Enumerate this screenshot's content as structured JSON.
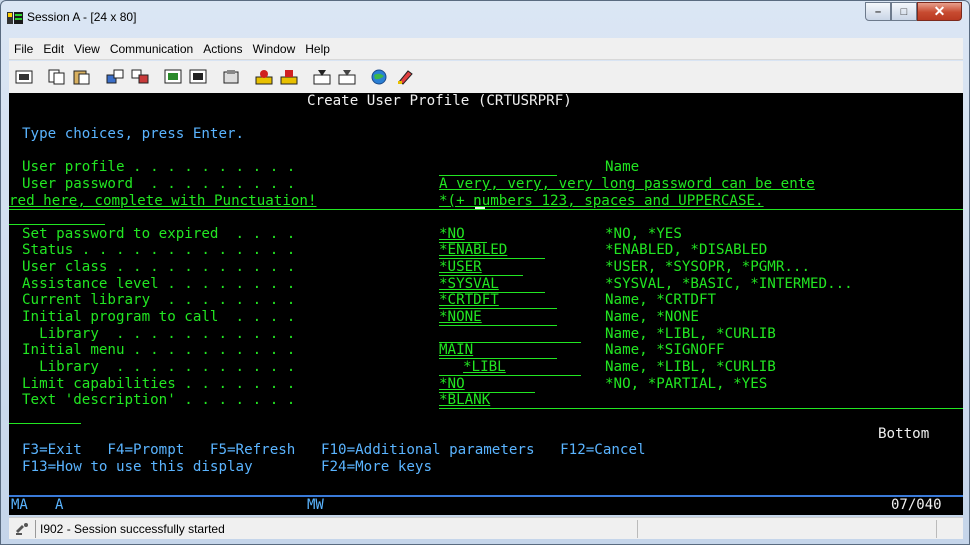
{
  "window": {
    "title": "Session A - [24 x 80]",
    "controls": {
      "minimize": "–",
      "maximize": "□",
      "close": "✕"
    }
  },
  "menu": [
    "File",
    "Edit",
    "View",
    "Communication",
    "Actions",
    "Window",
    "Help"
  ],
  "toolbar": {
    "icons": [
      "print-screen-icon",
      "copy-icon",
      "paste-icon",
      "send-icon",
      "receive-icon",
      "display-icon",
      "keyboard-icon",
      "macro-icon",
      "play-icon",
      "stop-icon",
      "record-icon",
      "quick-record-icon",
      "globe-icon",
      "customize-icon"
    ]
  },
  "terminal": {
    "screen_title": "Create User Profile (CRTUSRPRF)",
    "instruction": "Type choices, press Enter.",
    "fields": [
      {
        "label": "User profile . . . . . . . . . .",
        "value": "",
        "hint": "Name"
      },
      {
        "label": "User password  . . . . . . . . .",
        "value": "A very, very, very long password can be ente",
        "hint": ""
      },
      {
        "label": "red here, complete with Punctuation!",
        "value": "*(+ numbers 123, spaces and UPPERCASE.",
        "hint": ""
      },
      {
        "label": "Set password to expired  . . . .",
        "value": "*NO",
        "hint": "*NO, *YES"
      },
      {
        "label": "Status . . . . . . . . . . . . .",
        "value": "*ENABLED",
        "hint": "*ENABLED, *DISABLED"
      },
      {
        "label": "User class . . . . . . . . . . .",
        "value": "*USER",
        "hint": "*USER, *SYSOPR, *PGMR..."
      },
      {
        "label": "Assistance level . . . . . . . .",
        "value": "*SYSVAL",
        "hint": "*SYSVAL, *BASIC, *INTERMED..."
      },
      {
        "label": "Current library  . . . . . . . .",
        "value": "*CRTDFT",
        "hint": "Name, *CRTDFT"
      },
      {
        "label": "Initial program to call  . . . .",
        "value": "*NONE",
        "hint": "Name, *NONE"
      },
      {
        "label": "  Library  . . . . . . . . . . .",
        "value": "",
        "hint": "Name, *LIBL, *CURLIB"
      },
      {
        "label": "Initial menu . . . . . . . . . .",
        "value": "MAIN",
        "hint": "Name, *SIGNOFF"
      },
      {
        "label": "  Library  . . . . . . . . . . .",
        "value": "*LIBL",
        "hint": "Name, *LIBL, *CURLIB"
      },
      {
        "label": "Limit capabilities . . . . . . .",
        "value": "*NO",
        "hint": "*NO, *PARTIAL, *YES"
      },
      {
        "label": "Text 'description' . . . . . . .",
        "value": "*BLANK",
        "hint": ""
      }
    ],
    "bottom_label": "Bottom",
    "fkeys_line1": "F3=Exit   F4=Prompt   F5=Refresh   F10=Additional parameters   F12=Cancel",
    "fkeys_line2": "F13=How to use this display        F24=More keys"
  },
  "oia": {
    "left": "MA",
    "a": "A",
    "mw": "MW",
    "position": "07/040"
  },
  "status": {
    "message": "I902 - Session successfully started"
  },
  "colors": {
    "terminal_bg": "#000000",
    "green": "#22e622",
    "white": "#f0f0f0",
    "blue": "#5ab4ff"
  }
}
